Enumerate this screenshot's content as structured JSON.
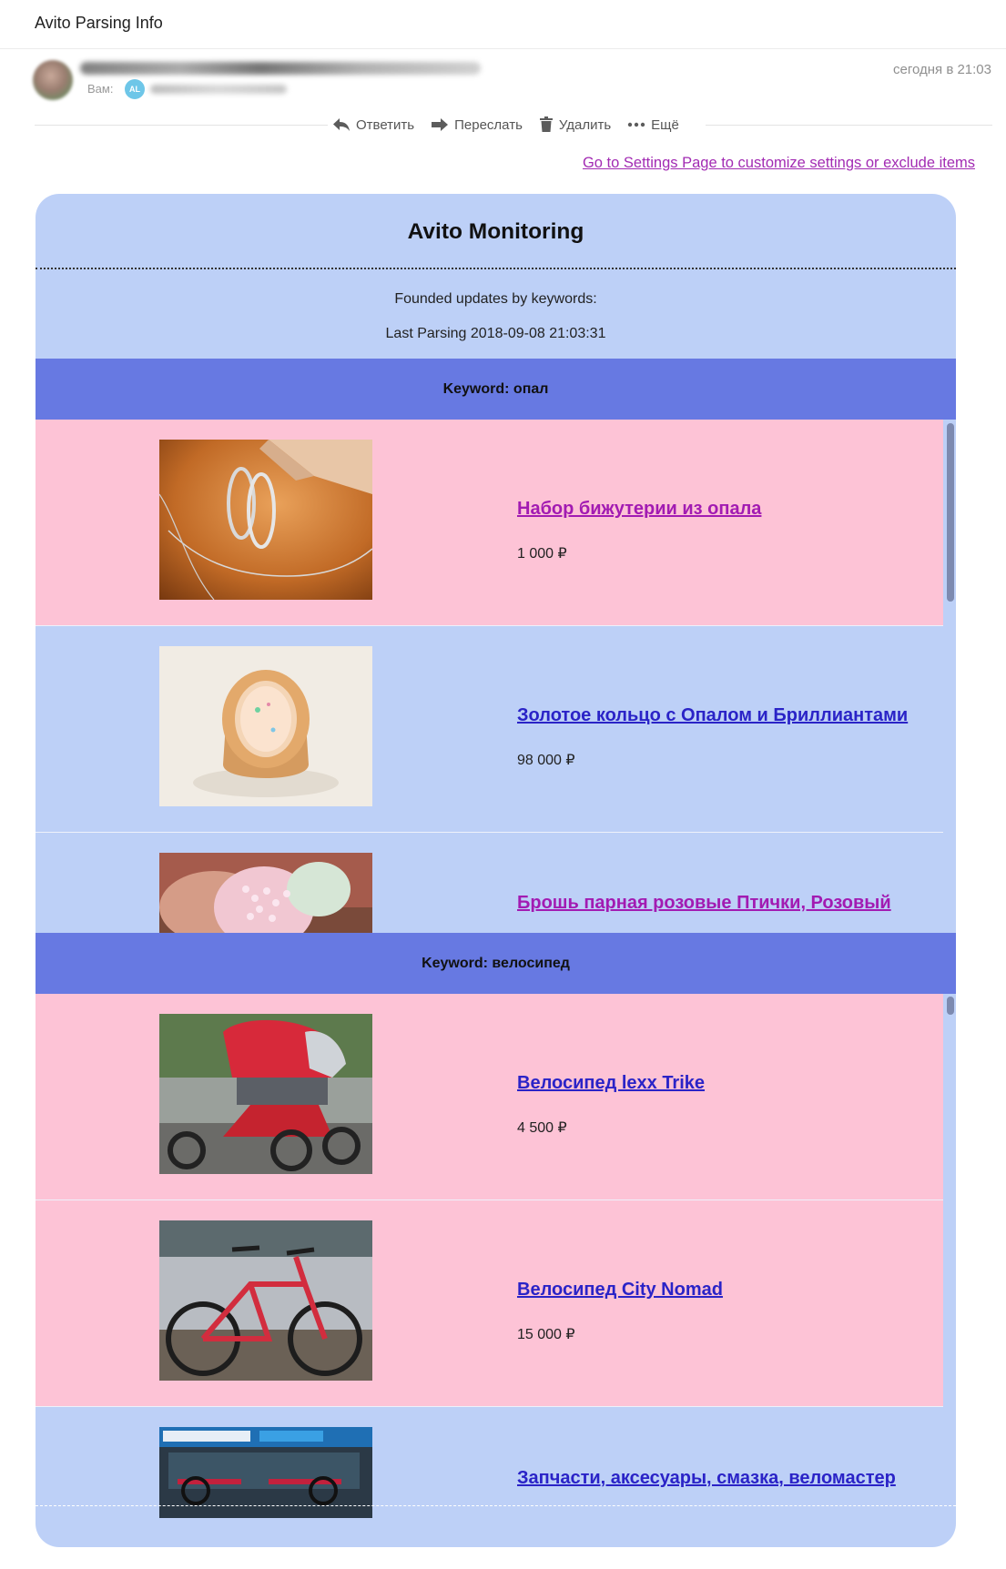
{
  "email": {
    "subject": "Avito Parsing Info",
    "to_label": "Вам:",
    "to_badge": "AL",
    "date": "сегодня в 21:03",
    "actions": {
      "reply": "Ответить",
      "forward": "Переслать",
      "delete": "Удалить",
      "more": "Ещё"
    }
  },
  "settings_link": "Go to Settings Page to customize settings or exclude items",
  "monitor": {
    "title": "Avito Monitoring",
    "founded": "Founded updates by keywords:",
    "last_parsing": "Last Parsing 2018-09-08 21:03:31"
  },
  "keywords": [
    {
      "label": "Keyword: опал",
      "items": [
        {
          "title": "Набор бижутерии из опала",
          "price": "1 000 ₽",
          "color": "#a21bb2"
        },
        {
          "title": "Золотое кольцо с Опалом и Бриллиантами",
          "price": "98 000 ₽",
          "color": "#2a23c7"
        },
        {
          "title": "Брошь парная розовые Птички, Розовый",
          "price": "",
          "color": "#a21bb2"
        }
      ]
    },
    {
      "label": "Keyword: велосипед",
      "items": [
        {
          "title": "Велосипед lexx Trike",
          "price": "4 500 ₽",
          "color": "#2a23c7"
        },
        {
          "title": "Велосипед City Nomad",
          "price": "15 000 ₽",
          "color": "#2a23c7"
        },
        {
          "title": "Запчасти, аксесуары, смазка, веломастер",
          "price": "",
          "color": "#2a23c7"
        }
      ]
    }
  ],
  "colors": {
    "card_bg": "#bdd0f7",
    "keyword_header": "#6779e2",
    "item_pink": "#fdc3d6",
    "link_purple": "#a21bb2",
    "link_blue": "#2a23c7"
  }
}
